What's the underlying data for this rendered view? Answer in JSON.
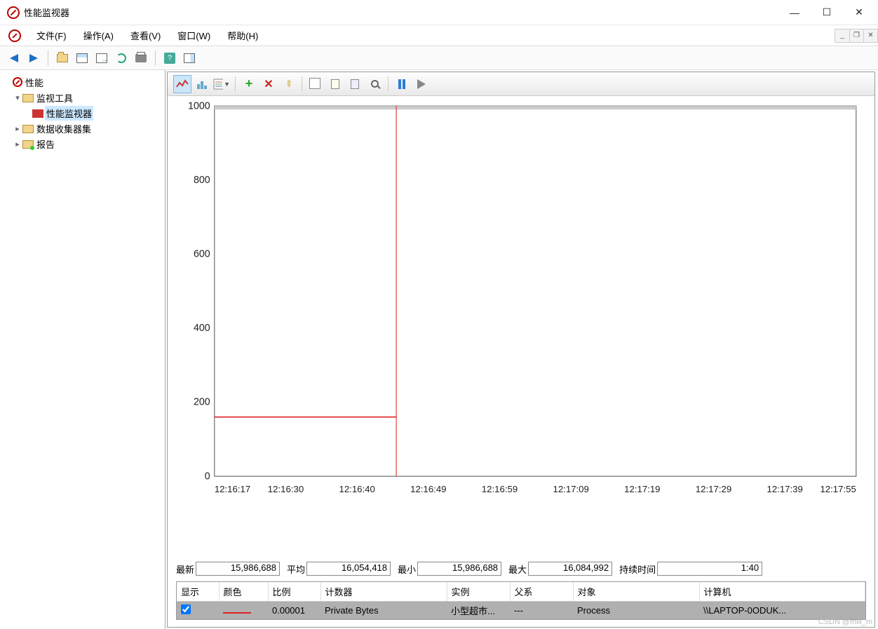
{
  "window": {
    "title": "性能监视器"
  },
  "menu": {
    "file": "文件(F)",
    "action": "操作(A)",
    "view": "查看(V)",
    "window": "窗口(W)",
    "help": "帮助(H)"
  },
  "tree": {
    "root": "性能",
    "monitor_tools": "监视工具",
    "perf_monitor": "性能监视器",
    "data_collector_sets": "数据收集器集",
    "reports": "报告"
  },
  "stats": {
    "latest_label": "最新",
    "latest": "15,986,688",
    "avg_label": "平均",
    "avg": "16,054,418",
    "min_label": "最小",
    "min": "15,986,688",
    "max_label": "最大",
    "max": "16,084,992",
    "duration_label": "持续时间",
    "duration": "1:40"
  },
  "legend": {
    "headers": {
      "show": "显示",
      "color": "颜色",
      "scale": "比例",
      "counter": "计数器",
      "instance": "实例",
      "parent": "父系",
      "object": "对象",
      "computer": "计算机"
    },
    "row": {
      "scale": "0.00001",
      "counter": "Private Bytes",
      "instance": "小型超市...",
      "parent": "---",
      "object": "Process",
      "computer": "\\\\LAPTOP-0ODUK..."
    }
  },
  "chart_data": {
    "type": "line",
    "ylim": [
      0,
      1000
    ],
    "yticks": [
      0,
      200,
      400,
      600,
      800,
      1000
    ],
    "xticks": [
      "12:16:17",
      "12:16:30",
      "12:16:40",
      "12:16:49",
      "12:16:59",
      "12:17:09",
      "12:17:19",
      "12:17:29",
      "12:17:39",
      "12:17:55"
    ],
    "series": [
      {
        "name": "Private Bytes",
        "color": "#d22",
        "x": [
          "12:16:17",
          "12:16:45"
        ],
        "values": [
          160,
          160
        ]
      }
    ],
    "cursor_x": "12:16:45"
  },
  "watermark": "CSDN @mili_m"
}
